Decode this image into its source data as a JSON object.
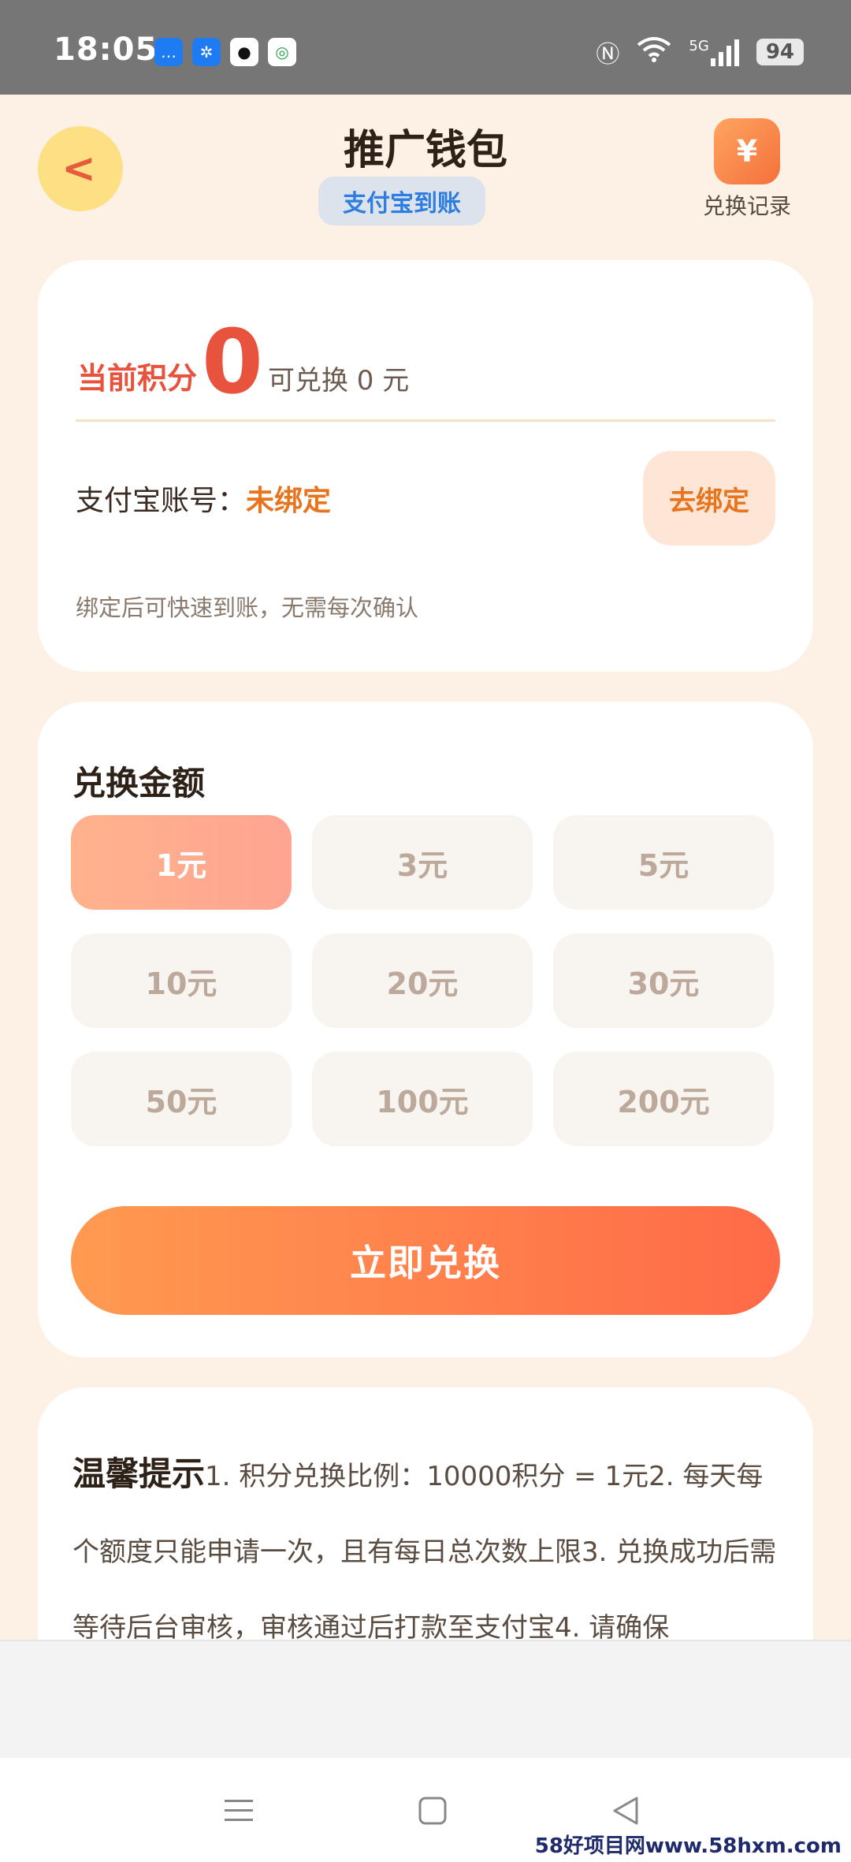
{
  "status_bar": {
    "time": "18:05",
    "battery": "94",
    "network": "5G",
    "apps": [
      {
        "icon": "message-app-icon",
        "color": "#1e7bf2"
      },
      {
        "icon": "fan-app-icon",
        "color": "#1e7bf2"
      },
      {
        "icon": "qq-app-icon",
        "color": "#111111"
      },
      {
        "icon": "china-mobile-app-icon",
        "color": "#ffffff"
      }
    ]
  },
  "header": {
    "title": "推广钱包",
    "badge": "支付宝到账",
    "back_icon": "<",
    "record_icon": "¥",
    "record_label": "兑换记录"
  },
  "points": {
    "label": "当前积分",
    "value": "0",
    "exchange_text": "可兑换 0 元"
  },
  "account": {
    "label": "支付宝账号：",
    "status": "未绑定",
    "bind_button": "去绑定",
    "hint": "绑定后可快速到账，无需每次确认"
  },
  "exchange": {
    "title": "兑换金额",
    "amounts": [
      "1元",
      "3元",
      "5元",
      "10元",
      "20元",
      "30元",
      "50元",
      "100元",
      "200元"
    ],
    "selected": "1元",
    "submit_button": "立即兑换"
  },
  "tips": {
    "title": "温馨提示",
    "text": "1. 积分兑换比例：10000积分 = 1元2. 每天每个额度只能申请一次，且有每日总次数上限3. 兑换成功后需等待后台审核，审核通过后打款至支付宝4. 请确保"
  },
  "watermark": "58好项目网www.58hxm.com",
  "colors": {
    "accent": "#e8533e",
    "orange": "#e8741e",
    "button_start": "#ff9a50",
    "button_end": "#ff6a48",
    "background": "#fdf1e6"
  }
}
